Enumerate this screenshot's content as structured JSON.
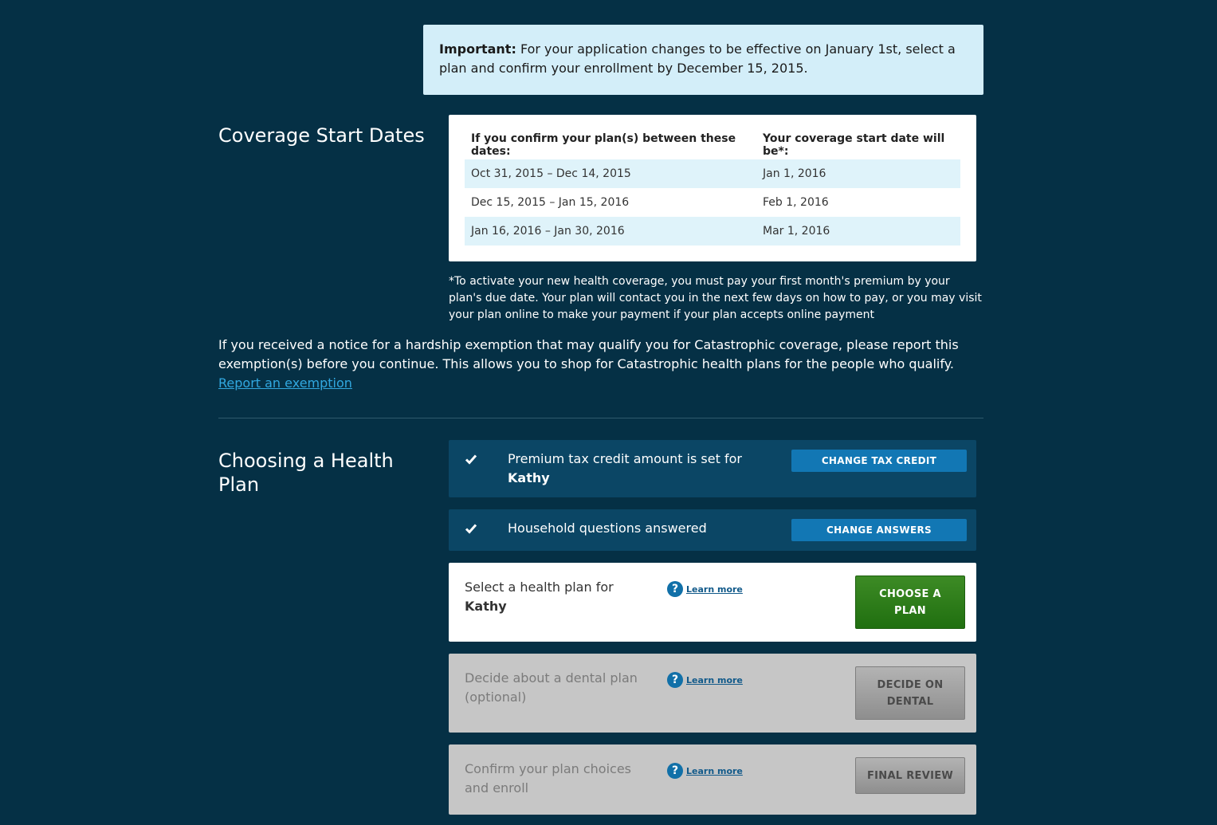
{
  "notice": {
    "label": "Important:",
    "text": "For your application changes to be effective on January 1st, select a plan and confirm your enrollment by December 15, 2015."
  },
  "coverage": {
    "title": "Coverage Start Dates",
    "headers": [
      "If you confirm your plan(s) between these dates:",
      "Your coverage start date will be*:"
    ],
    "rows": [
      [
        "Oct 31, 2015 – Dec 14, 2015",
        "Jan 1, 2016"
      ],
      [
        "Dec 15, 2015 – Jan 15, 2016",
        "Feb 1, 2016"
      ],
      [
        "Jan 16, 2016 – Jan 30, 2016",
        "Mar 1, 2016"
      ]
    ],
    "footnote": "*To activate your new health coverage, you must pay your first month's premium by your plan's due date. Your plan will contact you in the next few days on how to pay, or you may visit your plan online to make your payment if your plan accepts online payment"
  },
  "hardship": {
    "text": "If you received a notice for a hardship exemption that may qualify you for Catastrophic coverage, please report this exemption(s) before you continue. This allows you to shop for Catastrophic health plans for the people who qualify.",
    "link": "Report an exemption"
  },
  "choosing": {
    "title": "Choosing a Health Plan",
    "tax_credit": {
      "text": "Premium tax credit amount is set for",
      "name": "Kathy",
      "button": "CHANGE TAX CREDIT"
    },
    "household": {
      "text": "Household questions answered",
      "button": "CHANGE ANSWERS"
    },
    "select_plan": {
      "text": "Select a health plan for",
      "name": "Kathy",
      "learn_more": "Learn more",
      "button": "CHOOSE A PLAN"
    },
    "dental": {
      "text": "Decide about a dental plan (optional)",
      "learn_more": "Learn more",
      "button": "DECIDE ON DENTAL"
    },
    "confirm": {
      "text": "Confirm your plan choices and enroll",
      "learn_more": "Learn more",
      "button": "FINAL REVIEW"
    }
  },
  "colors": {
    "background": "#053045",
    "notice_bg": "#d3eef9",
    "status_row_bg": "#0b4665",
    "status_button": "#1277b4",
    "primary_button": "#2f7d1b",
    "disabled_card": "#c6c6c6",
    "link": "#31a8e0"
  }
}
